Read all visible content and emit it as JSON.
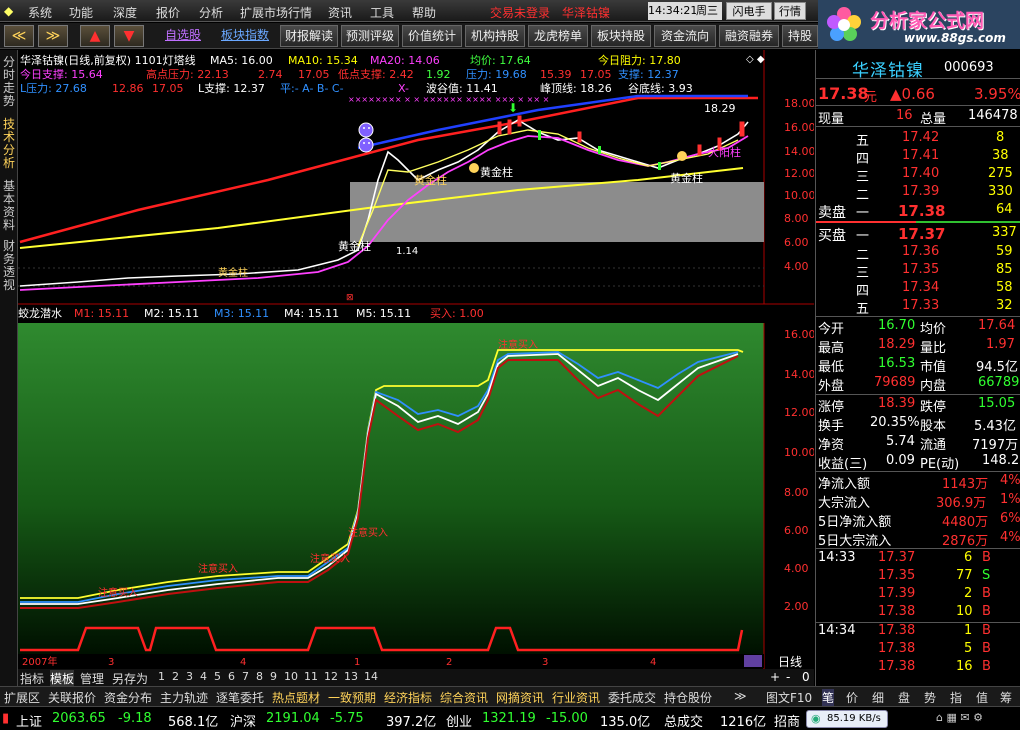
{
  "menu": {
    "items": [
      "系统",
      "功能",
      "深度",
      "报价",
      "分析",
      "扩展市场行情",
      "资讯",
      "工具",
      "帮助"
    ],
    "notice": "交易未登录",
    "stock_title": "华泽钴镍",
    "time": "14:34:21",
    "weekday": "周三",
    "btn1": "闪电手",
    "btn2": "行情"
  },
  "toolbar": {
    "nav_back": "≪",
    "nav_fwd": "≫",
    "nav_up": "▲",
    "nav_down": "▼",
    "link1": "自选股",
    "link2": "板块指数",
    "items": [
      "财报解读",
      "预测评级",
      "价值统计",
      "机构持股",
      "龙虎榜单",
      "板块持股",
      "资金流向",
      "融资融券",
      "持股变"
    ]
  },
  "logo": {
    "cn": "分析家公式网",
    "url": "www.88gs.com"
  },
  "left_tabs": [
    "分时走势",
    "技术分析",
    "基本资料",
    "财务透视"
  ],
  "main_chart": {
    "header": "华泽钴镍(日线,前复权) 1101灯塔线",
    "ma5": "MA5: 16.00",
    "ma10": "MA10: 15.34",
    "ma20": "MA20: 14.06",
    "avg": "均价: 17.64",
    "resist": "今日阻力: 17.80",
    "line2_a": "今日支撑: 15.64",
    "line2_b": "高点压力: 22.13",
    "line2_c": "2.74",
    "line2_d": "17.05",
    "line2_e": "低点支撑: 2.42",
    "line2_f": "1.92",
    "line2_g": "压力: 19.68",
    "line2_h": "15.39",
    "line2_i": "17.05",
    "line2_j": "支撑: 12.37",
    "line3_a": "L压力: 27.68",
    "line3_b": "12.86",
    "line3_c": "17.05",
    "line3_d": "L支撑: 12.37",
    "line3_e": "平:- A- B- C-",
    "line3_f": "X-",
    "line3_g": "波谷值: 11.41",
    "line3_h": "峰顶线: 18.26",
    "line3_i": "谷底线: 3.93",
    "price_hi": "18.29",
    "price_lo": "1.14",
    "labels": [
      "黄金柱",
      "黄金柱",
      "黄金柱",
      "黄金柱",
      "大阳柱",
      "黄金柱"
    ],
    "y_ticks": [
      "18.00",
      "16.00",
      "14.00",
      "12.00",
      "10.00",
      "8.00",
      "6.00",
      "4.00"
    ]
  },
  "sub_chart": {
    "name": "蛟龙潜水",
    "m1": "M1: 15.11",
    "m2": "M2: 15.11",
    "m3": "M3: 15.11",
    "m4": "M4: 15.11",
    "m5": "M5: 15.11",
    "buy": "买入: 1.00",
    "tip": "注意买入",
    "y_ticks": [
      "16.00",
      "14.00",
      "12.00",
      "10.00",
      "8.00",
      "6.00",
      "4.00",
      "2.00"
    ],
    "x_labels": [
      "2007年",
      "3",
      "4",
      "1",
      "2",
      "3",
      "4"
    ]
  },
  "chart_tabs": {
    "items": [
      "指标",
      "模板",
      "管理",
      "另存为",
      "1",
      "2",
      "3",
      "4",
      "5",
      "6",
      "7",
      "8",
      "9",
      "10",
      "11",
      "12",
      "13",
      "14"
    ],
    "period": "日线",
    "plus": "+",
    "minus": "-",
    "zero": "0"
  },
  "quote": {
    "name": "华泽钴镍",
    "code": "000693",
    "price": "17.38",
    "unit": "元",
    "change": "▲0.66",
    "pct": "3.95%",
    "now_label": "现量",
    "now_val": "16",
    "total_label": "总量",
    "total_val": "146478",
    "sell": [
      {
        "lv": "五",
        "p": "17.42",
        "v": "8"
      },
      {
        "lv": "四",
        "p": "17.41",
        "v": "38"
      },
      {
        "lv": "三",
        "p": "17.40",
        "v": "275"
      },
      {
        "lv": "二",
        "p": "17.39",
        "v": "330"
      },
      {
        "lv": "一",
        "p": "17.38",
        "v": "64"
      }
    ],
    "buy": [
      {
        "lv": "一",
        "p": "17.37",
        "v": "337"
      },
      {
        "lv": "二",
        "p": "17.36",
        "v": "59"
      },
      {
        "lv": "三",
        "p": "17.35",
        "v": "85"
      },
      {
        "lv": "四",
        "p": "17.34",
        "v": "58"
      },
      {
        "lv": "五",
        "p": "17.33",
        "v": "32"
      }
    ],
    "sell_label": "卖盘",
    "buy_label": "买盘",
    "stats": [
      [
        "今开",
        "16.70",
        "均价",
        "17.64"
      ],
      [
        "最高",
        "18.29",
        "量比",
        "1.97"
      ],
      [
        "最低",
        "16.53",
        "市值",
        "94.5亿"
      ],
      [
        "外盘",
        "79689",
        "内盘",
        "66789"
      ],
      [
        "涨停",
        "18.39",
        "跌停",
        "15.05"
      ],
      [
        "换手",
        "20.35%",
        "股本",
        "5.43亿"
      ],
      [
        "净资",
        "5.74",
        "流通",
        "7197万"
      ],
      [
        "收益(三)",
        "0.09",
        "PE(动)",
        "148.2"
      ]
    ],
    "flows": [
      [
        "净流入额",
        "1143万",
        "4%"
      ],
      [
        "大宗流入",
        "306.9万",
        "1%"
      ],
      [
        "5日净流入额",
        "4480万",
        "6%"
      ],
      [
        "5日大宗流入",
        "2876万",
        "4%"
      ]
    ],
    "ticks": [
      [
        "14:33",
        "17.37",
        "6",
        "B"
      ],
      [
        "",
        "17.35",
        "77",
        "S"
      ],
      [
        "",
        "17.39",
        "2",
        "B"
      ],
      [
        "",
        "17.38",
        "10",
        "B"
      ],
      [
        "14:34",
        "17.38",
        "1",
        "B"
      ],
      [
        "",
        "17.38",
        "5",
        "B"
      ],
      [
        "",
        "17.38",
        "16",
        "B"
      ]
    ]
  },
  "bottom_tabs": {
    "items": [
      "扩展区",
      "关联报价",
      "资金分布",
      "主力轨迹",
      "逐笔委托",
      "热点题材",
      "一致预期",
      "经济指标",
      "综合资讯",
      "网摘资讯",
      "行业资讯",
      "委托成交",
      "持仓股份"
    ],
    "more": "≫",
    "right": [
      "图文F10",
      "笔",
      "价",
      "细",
      "盘",
      "势",
      "指",
      "值",
      "筹"
    ]
  },
  "statusbar": {
    "sh_label": "上证",
    "sh": "2063.65",
    "sh_chg": "-9.18",
    "sh_amt": "568.1亿",
    "hs_label": "沪深",
    "hs": "2191.04",
    "hs_chg": "-5.75",
    "hs_amt": "397.2亿",
    "cy_label": "创业",
    "cy": "1321.19",
    "cy_chg": "-15.00",
    "cy_amt": "135.0亿",
    "total_label": "总成交",
    "total": "1216亿",
    "zs": "招商",
    "speed": "85.19 KB/s"
  }
}
